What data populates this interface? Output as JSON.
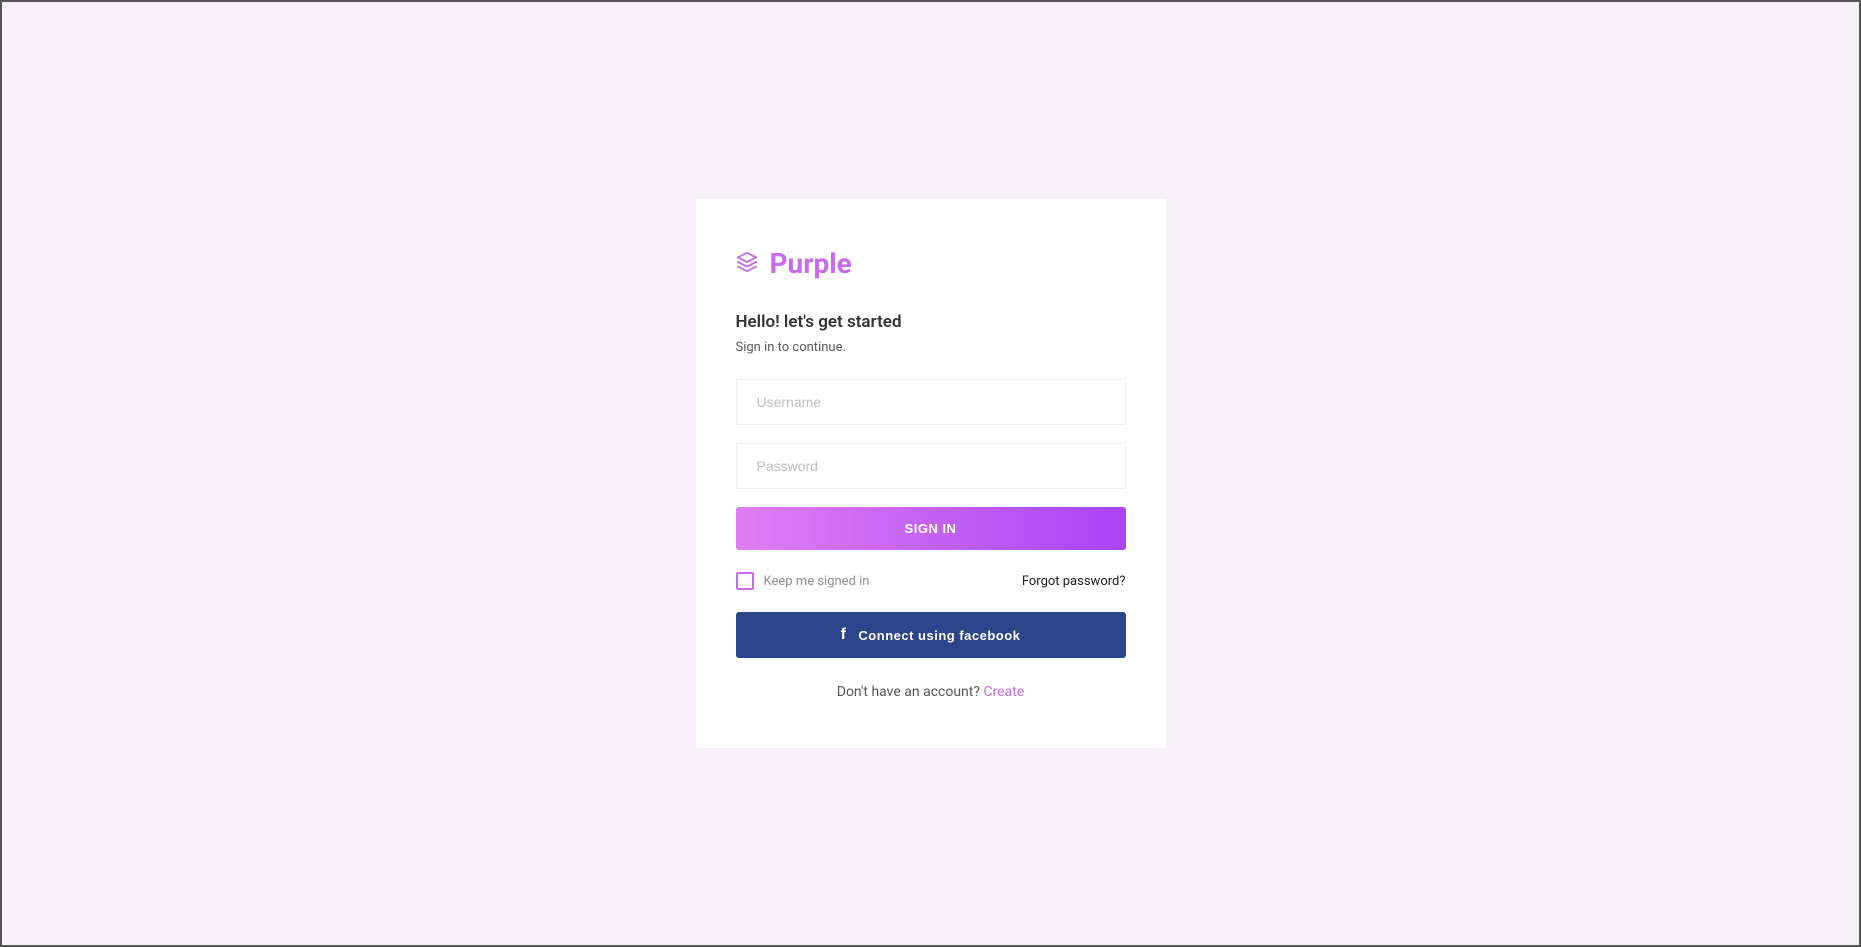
{
  "brand": {
    "name": "Purple"
  },
  "heading": "Hello! let's get started",
  "subheading": "Sign in to continue.",
  "form": {
    "username_placeholder": "Username",
    "password_placeholder": "Password",
    "signin_button": "SIGN IN",
    "keep_signed_label": "Keep me signed in",
    "forgot_link": "Forgot password?",
    "facebook_button": "Connect using facebook"
  },
  "footer": {
    "prompt": "Don't have an account? ",
    "create_link": "Create"
  }
}
